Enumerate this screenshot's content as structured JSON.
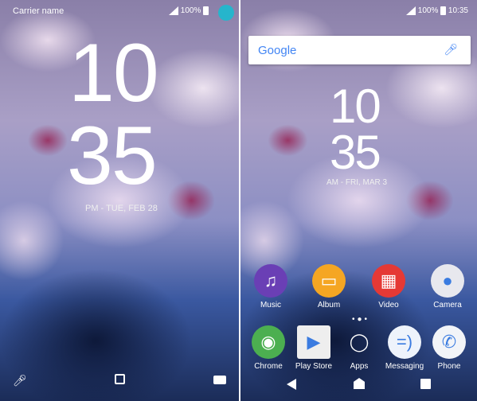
{
  "lock": {
    "carrier": "Carrier name",
    "battery": "100%",
    "hour": "10",
    "minute": "35",
    "date": "PM - TUE, FEB 28"
  },
  "home": {
    "battery": "100%",
    "time": "10:35",
    "search_logo": "Google",
    "hour": "10",
    "minute": "35",
    "date": "AM - FRI, MAR 3",
    "row1": [
      {
        "label": "Music",
        "color": "#6a3fb5",
        "glyph": "♫"
      },
      {
        "label": "Album",
        "color": "#f5a623",
        "glyph": "▭"
      },
      {
        "label": "Video",
        "color": "#e53935",
        "glyph": "▦"
      },
      {
        "label": "Camera",
        "color": "#e8e8ee",
        "glyph": "●"
      }
    ],
    "dock": [
      {
        "label": "Chrome",
        "color": "#4caf50",
        "glyph": "◉"
      },
      {
        "label": "Play Store",
        "color": "#eeeeee",
        "glyph": "▶"
      },
      {
        "label": "Apps",
        "color": "transparent",
        "glyph": "◯"
      },
      {
        "label": "Messaging",
        "color": "#eef3fb",
        "glyph": "=)"
      },
      {
        "label": "Phone",
        "color": "#f2f4f8",
        "glyph": "✆"
      }
    ]
  }
}
